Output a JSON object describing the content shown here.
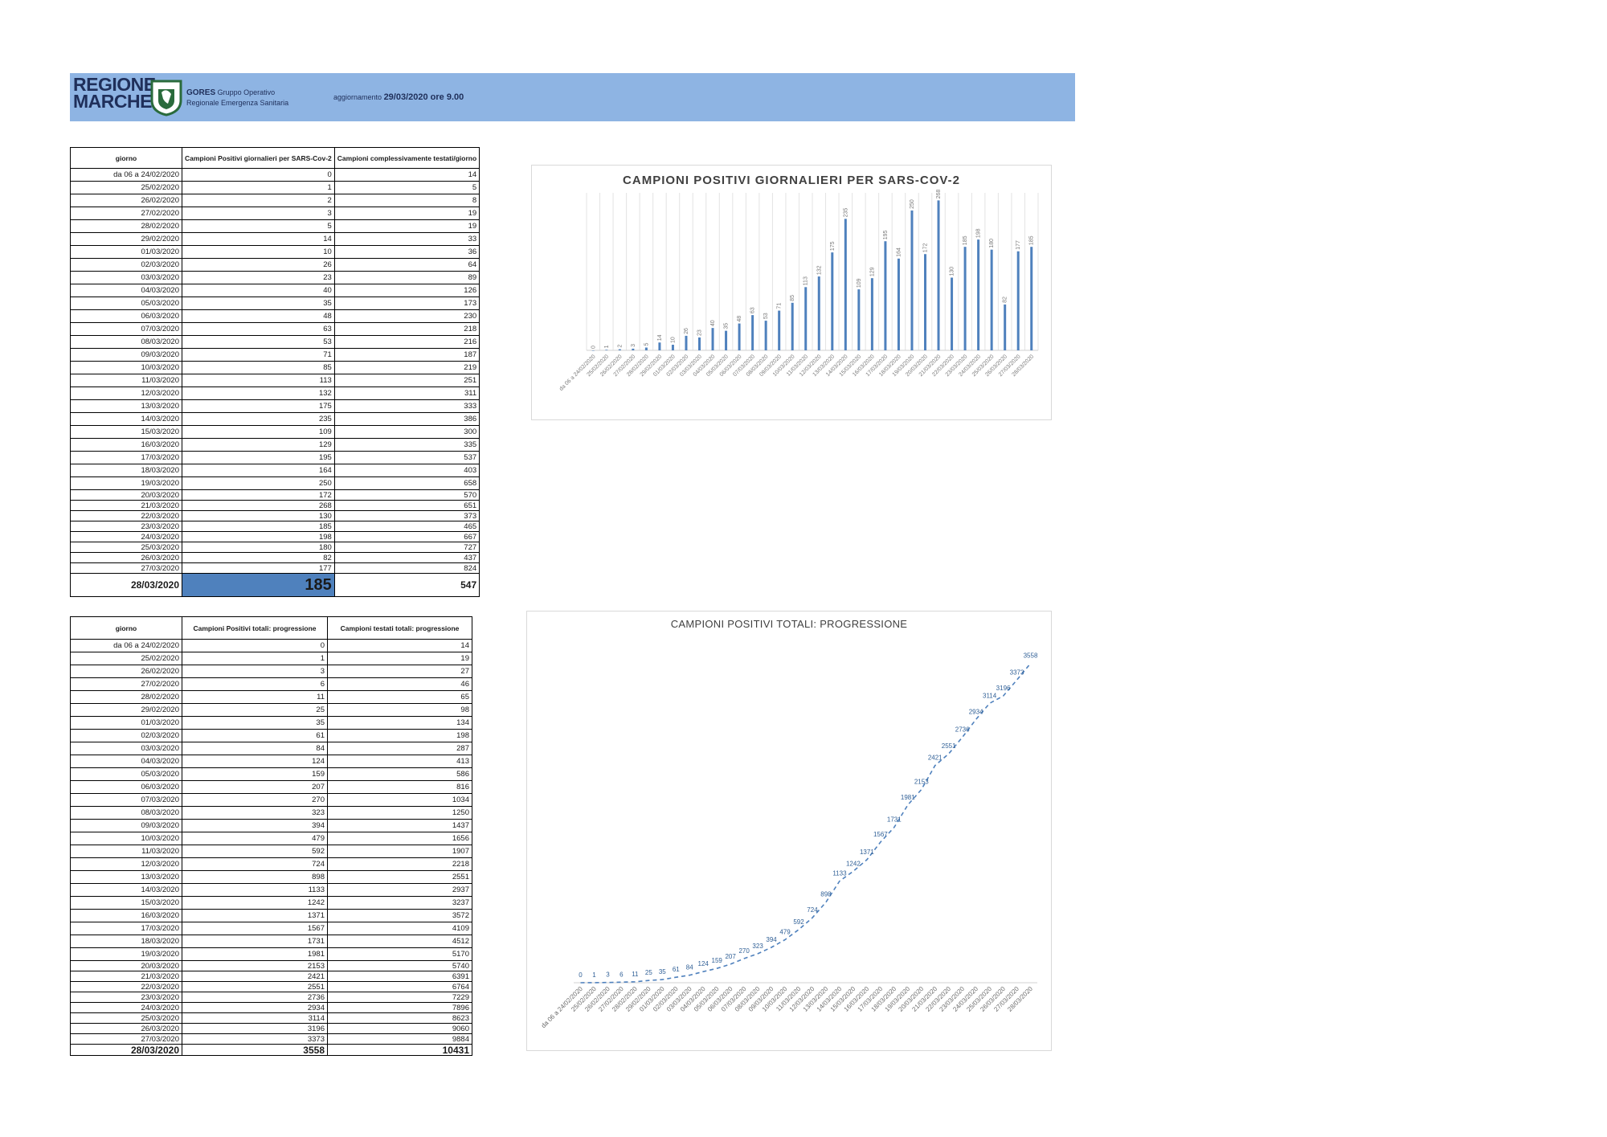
{
  "header": {
    "logo_line1": "REGIONE",
    "logo_line2": "MARCHE",
    "gores_name": "GORES",
    "gores_desc": "Gruppo Operativo Regionale Emergenza Sanitaria",
    "update_label": "aggiornamento",
    "update_value": "29/03/2020 ore 9.00",
    "colors": {
      "band": "#8eb4e3",
      "logo_text": "#1f2f5a"
    }
  },
  "table1": {
    "headers": [
      "giorno",
      "Campioni Positivi giornalieri per SARS-Cov-2",
      "Campioni complessivamente testati/giorno"
    ],
    "rows": [
      [
        "da 06 a 24/02/2020",
        "0",
        "14"
      ],
      [
        "25/02/2020",
        "1",
        "5"
      ],
      [
        "26/02/2020",
        "2",
        "8"
      ],
      [
        "27/02/2020",
        "3",
        "19"
      ],
      [
        "28/02/2020",
        "5",
        "19"
      ],
      [
        "29/02/2020",
        "14",
        "33"
      ],
      [
        "01/03/2020",
        "10",
        "36"
      ],
      [
        "02/03/2020",
        "26",
        "64"
      ],
      [
        "03/03/2020",
        "23",
        "89"
      ],
      [
        "04/03/2020",
        "40",
        "126"
      ],
      [
        "05/03/2020",
        "35",
        "173"
      ],
      [
        "06/03/2020",
        "48",
        "230"
      ],
      [
        "07/03/2020",
        "63",
        "218"
      ],
      [
        "08/03/2020",
        "53",
        "216"
      ],
      [
        "09/03/2020",
        "71",
        "187"
      ],
      [
        "10/03/2020",
        "85",
        "219"
      ],
      [
        "11/03/2020",
        "113",
        "251"
      ],
      [
        "12/03/2020",
        "132",
        "311"
      ],
      [
        "13/03/2020",
        "175",
        "333"
      ],
      [
        "14/03/2020",
        "235",
        "386"
      ],
      [
        "15/03/2020",
        "109",
        "300"
      ],
      [
        "16/03/2020",
        "129",
        "335"
      ],
      [
        "17/03/2020",
        "195",
        "537"
      ],
      [
        "18/03/2020",
        "164",
        "403"
      ],
      [
        "19/03/2020",
        "250",
        "658"
      ],
      [
        "20/03/2020",
        "172",
        "570"
      ],
      [
        "21/03/2020",
        "268",
        "651"
      ],
      [
        "22/03/2020",
        "130",
        "373"
      ],
      [
        "23/03/2020",
        "185",
        "465"
      ],
      [
        "24/03/2020",
        "198",
        "667"
      ],
      [
        "25/03/2020",
        "180",
        "727"
      ],
      [
        "26/03/2020",
        "82",
        "437"
      ],
      [
        "27/03/2020",
        "177",
        "824"
      ]
    ],
    "last_row": [
      "28/03/2020",
      "185",
      "547"
    ],
    "highlight_color": "#4f81bd"
  },
  "table2": {
    "headers": [
      "giorno",
      "Campioni Positivi totali: progressione",
      "Campioni testati totali: progressione"
    ],
    "rows": [
      [
        "da 06 a 24/02/2020",
        "0",
        "14"
      ],
      [
        "25/02/2020",
        "1",
        "19"
      ],
      [
        "26/02/2020",
        "3",
        "27"
      ],
      [
        "27/02/2020",
        "6",
        "46"
      ],
      [
        "28/02/2020",
        "11",
        "65"
      ],
      [
        "29/02/2020",
        "25",
        "98"
      ],
      [
        "01/03/2020",
        "35",
        "134"
      ],
      [
        "02/03/2020",
        "61",
        "198"
      ],
      [
        "03/03/2020",
        "84",
        "287"
      ],
      [
        "04/03/2020",
        "124",
        "413"
      ],
      [
        "05/03/2020",
        "159",
        "586"
      ],
      [
        "06/03/2020",
        "207",
        "816"
      ],
      [
        "07/03/2020",
        "270",
        "1034"
      ],
      [
        "08/03/2020",
        "323",
        "1250"
      ],
      [
        "09/03/2020",
        "394",
        "1437"
      ],
      [
        "10/03/2020",
        "479",
        "1656"
      ],
      [
        "11/03/2020",
        "592",
        "1907"
      ],
      [
        "12/03/2020",
        "724",
        "2218"
      ],
      [
        "13/03/2020",
        "898",
        "2551"
      ],
      [
        "14/03/2020",
        "1133",
        "2937"
      ],
      [
        "15/03/2020",
        "1242",
        "3237"
      ],
      [
        "16/03/2020",
        "1371",
        "3572"
      ],
      [
        "17/03/2020",
        "1567",
        "4109"
      ],
      [
        "18/03/2020",
        "1731",
        "4512"
      ],
      [
        "19/03/2020",
        "1981",
        "5170"
      ],
      [
        "20/03/2020",
        "2153",
        "5740"
      ],
      [
        "21/03/2020",
        "2421",
        "6391"
      ],
      [
        "22/03/2020",
        "2551",
        "6764"
      ],
      [
        "23/03/2020",
        "2736",
        "7229"
      ],
      [
        "24/03/2020",
        "2934",
        "7896"
      ],
      [
        "25/03/2020",
        "3114",
        "8623"
      ],
      [
        "26/03/2020",
        "3196",
        "9060"
      ],
      [
        "27/03/2020",
        "3373",
        "9884"
      ]
    ],
    "last_row": [
      "28/03/2020",
      "3558",
      "10431"
    ]
  },
  "chart_data": [
    {
      "type": "bar",
      "title": "CAMPIONI POSITIVI GIORNALIERI PER SARS-COV-2",
      "categories": [
        "da 06 a 24/02/2020",
        "25/02/2020",
        "26/02/2020",
        "27/02/2020",
        "28/02/2020",
        "29/02/2020",
        "01/03/2020",
        "02/03/2020",
        "03/03/2020",
        "04/03/2020",
        "05/03/2020",
        "06/03/2020",
        "07/03/2020",
        "08/03/2020",
        "09/03/2020",
        "10/03/2020",
        "11/03/2020",
        "12/03/2020",
        "13/03/2020",
        "14/03/2020",
        "15/03/2020",
        "16/03/2020",
        "17/03/2020",
        "18/03/2020",
        "19/03/2020",
        "20/03/2020",
        "21/03/2020",
        "22/03/2020",
        "23/03/2020",
        "24/03/2020",
        "25/03/2020",
        "26/03/2020",
        "27/03/2020",
        "28/03/2020"
      ],
      "values": [
        0,
        1,
        2,
        3,
        5,
        14,
        10,
        26,
        23,
        40,
        35,
        48,
        63,
        53,
        71,
        85,
        113,
        132,
        175,
        235,
        109,
        129,
        195,
        164,
        250,
        172,
        268,
        130,
        185,
        198,
        180,
        82,
        177,
        185
      ],
      "ylim": [
        0,
        270
      ],
      "grid": "vertical",
      "color": "#4f81bd"
    },
    {
      "type": "line",
      "title": "CAMPIONI POSITIVI TOTALI: PROGRESSIONE",
      "categories": [
        "da 06 a 24/02/2020",
        "25/02/2020",
        "26/02/2020",
        "27/02/2020",
        "28/02/2020",
        "29/02/2020",
        "01/03/2020",
        "02/03/2020",
        "03/03/2020",
        "04/03/2020",
        "05/03/2020",
        "06/03/2020",
        "07/03/2020",
        "08/03/2020",
        "09/03/2020",
        "10/03/2020",
        "11/03/2020",
        "12/03/2020",
        "13/03/2020",
        "14/03/2020",
        "15/03/2020",
        "16/03/2020",
        "17/03/2020",
        "18/03/2020",
        "19/03/2020",
        "20/03/2020",
        "21/03/2020",
        "22/03/2020",
        "23/03/2020",
        "24/03/2020",
        "25/03/2020",
        "26/03/2020",
        "27/03/2020",
        "28/03/2020"
      ],
      "values": [
        0,
        1,
        3,
        6,
        11,
        25,
        35,
        61,
        84,
        124,
        159,
        207,
        270,
        323,
        394,
        479,
        592,
        724,
        898,
        1133,
        1242,
        1371,
        1567,
        1731,
        1981,
        2153,
        2421,
        2551,
        2736,
        2934,
        3114,
        3196,
        3373,
        3558
      ],
      "ylim": [
        0,
        3600
      ],
      "line_style": "dashed",
      "grid": "none",
      "color": "#4f81bd"
    }
  ]
}
